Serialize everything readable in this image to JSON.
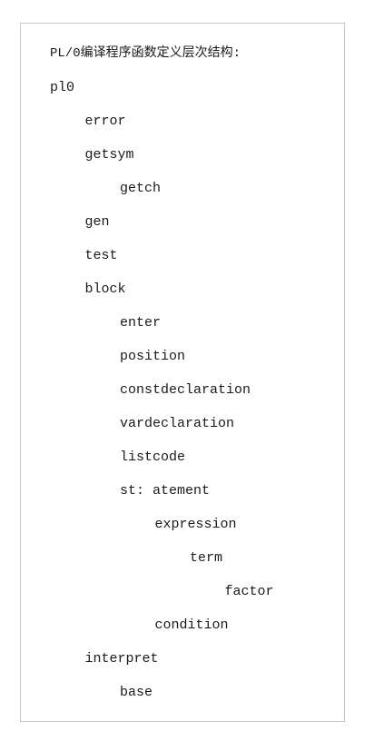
{
  "document": {
    "title": "PL/0编译程序函数定义层次结构:",
    "tree": [
      {
        "label": "pl0",
        "depth": 0
      },
      {
        "label": "error",
        "depth": 1
      },
      {
        "label": "getsym",
        "depth": 1
      },
      {
        "label": "getch",
        "depth": 2
      },
      {
        "label": "gen",
        "depth": 1
      },
      {
        "label": "test",
        "depth": 1
      },
      {
        "label": "block",
        "depth": 1
      },
      {
        "label": "enter",
        "depth": 2
      },
      {
        "label": "position",
        "depth": 2
      },
      {
        "label": "constdeclaration",
        "depth": 2
      },
      {
        "label": "vardeclaration",
        "depth": 2
      },
      {
        "label": "listcode",
        "depth": 2
      },
      {
        "label": "st: atement",
        "depth": 2
      },
      {
        "label": "expression",
        "depth": 3
      },
      {
        "label": "term",
        "depth": 4
      },
      {
        "label": "factor",
        "depth": 5
      },
      {
        "label": "condition",
        "depth": 3
      },
      {
        "label": "interpret",
        "depth": 1
      },
      {
        "label": "base",
        "depth": 2
      }
    ]
  }
}
